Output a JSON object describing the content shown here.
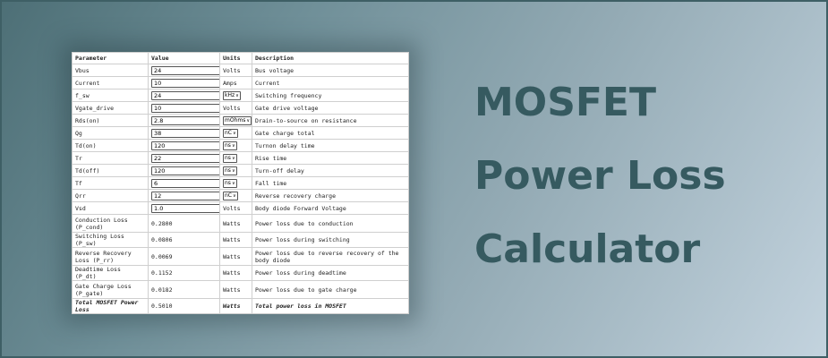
{
  "headers": [
    "Parameter",
    "Value",
    "Units",
    "Description"
  ],
  "inputs": [
    {
      "param": "Vbus",
      "value": "24",
      "unit": "Volts",
      "unit_select": false,
      "desc": "Bus voltage"
    },
    {
      "param": "Current",
      "value": "10",
      "unit": "Amps",
      "unit_select": false,
      "desc": "Current"
    },
    {
      "param": "f_sw",
      "value": "24",
      "unit": "kHz",
      "unit_select": true,
      "desc": "Switching frequency"
    },
    {
      "param": "Vgate_drive",
      "value": "10",
      "unit": "Volts",
      "unit_select": false,
      "desc": "Gate drive voltage"
    },
    {
      "param": "Rds(on)",
      "value": "2.8",
      "unit": "mOhms",
      "unit_select": true,
      "desc": "Drain-to-source on resistance"
    },
    {
      "param": "Qg",
      "value": "38",
      "unit": "nC",
      "unit_select": true,
      "desc": "Gate charge total"
    },
    {
      "param": "Td(on)",
      "value": "120",
      "unit": "ns",
      "unit_select": true,
      "desc": "Turnon delay time"
    },
    {
      "param": "Tr",
      "value": "22",
      "unit": "ns",
      "unit_select": true,
      "desc": "Rise time"
    },
    {
      "param": "Td(off)",
      "value": "120",
      "unit": "ns",
      "unit_select": true,
      "desc": "Turn-off delay"
    },
    {
      "param": "Tf",
      "value": "6",
      "unit": "ns",
      "unit_select": true,
      "desc": "Fall time"
    },
    {
      "param": "Qrr",
      "value": "12",
      "unit": "nC",
      "unit_select": true,
      "desc": "Reverse recovery charge"
    },
    {
      "param": "Vsd",
      "value": "1.0",
      "unit": "Volts",
      "unit_select": false,
      "desc": "Body diode Forward Voltage"
    }
  ],
  "outputs": [
    {
      "param": "Conduction Loss (P_cond)",
      "value": "0.2800",
      "unit": "Watts",
      "desc": "Power loss due to conduction",
      "tall": true
    },
    {
      "param": "Switching Loss (P_sw)",
      "value": "0.0806",
      "unit": "Watts",
      "desc": "Power loss during switching",
      "tall": false
    },
    {
      "param": "Reverse Recovery Loss (P_rr)",
      "value": "0.0069",
      "unit": "Watts",
      "desc": "Power loss due to reverse recovery of the body diode",
      "tall": true
    },
    {
      "param": "Deadtime Loss (P_dt)",
      "value": "0.1152",
      "unit": "Watts",
      "desc": "Power loss during deadtime",
      "tall": false
    },
    {
      "param": "Gate Charge Loss (P_gate)",
      "value": "0.0182",
      "unit": "Watts",
      "desc": "Power loss due to gate charge",
      "tall": true
    }
  ],
  "total": {
    "param": "Total MOSFET Power Loss",
    "value": "0.5010",
    "unit": "Watts",
    "desc": "Total power loss in MOSFET"
  },
  "title_lines": [
    "MOSFET",
    "Power Loss",
    "Calculator"
  ]
}
